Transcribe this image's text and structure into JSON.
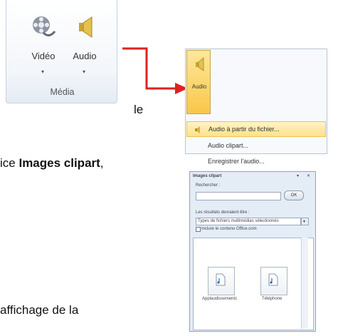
{
  "ribbon": {
    "video_label": "Vidéo",
    "audio_label": "Audio",
    "caret": "▾",
    "group_label": "Média"
  },
  "fragments": {
    "le": "le",
    "images_prefix": "ice ",
    "images_bold": "Images clipart",
    "images_suffix": ",",
    "affichage": "affichage de la"
  },
  "audio_menu": {
    "button_label": "Audio",
    "items": [
      "Audio à partir du fichier...",
      "Audio clipart...",
      "Enregistrer l'audio..."
    ]
  },
  "clip_panel": {
    "title": "Images clipart",
    "search_label": "Rechercher :",
    "ok_label": "OK",
    "results_label": "Les résultats devraient être :",
    "select_value": "Types de fichiers multimédias sélectionnés",
    "checkbox_label": "Inclure le contenu Office.com",
    "items": [
      "Applaudissements",
      "Téléphone"
    ]
  },
  "colors": {
    "arrow": "#e02020",
    "highlight": "#fde18a"
  }
}
